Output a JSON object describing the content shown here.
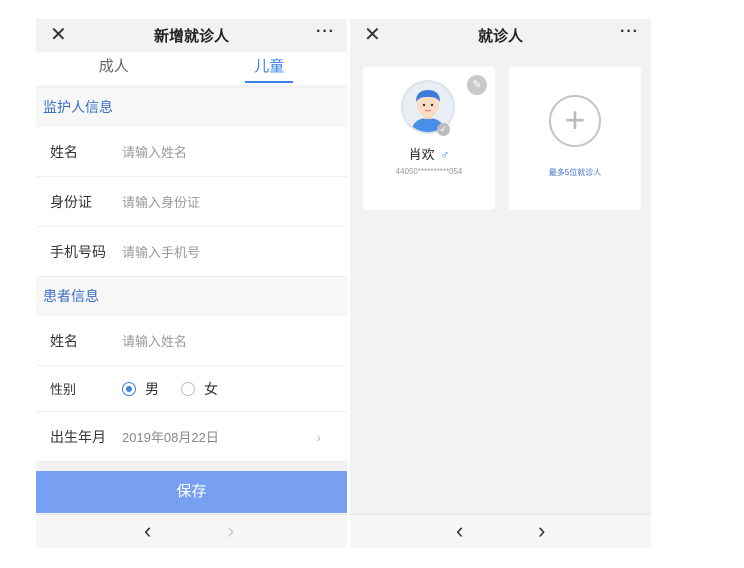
{
  "left_screen": {
    "titlebar": {
      "close_glyph": "✕",
      "title": "新增就诊人",
      "more_glyph": "···"
    },
    "tabs": [
      {
        "label": "成人",
        "active": false
      },
      {
        "label": "儿童",
        "active": true
      }
    ],
    "guardian_section": {
      "heading": "监护人信息",
      "rows": [
        {
          "label": "姓名",
          "placeholder": "请输入姓名"
        },
        {
          "label": "身份证",
          "placeholder": "请输入身份证"
        },
        {
          "label": "手机号码",
          "placeholder": "请输入手机号"
        }
      ]
    },
    "patient_section": {
      "heading": "患者信息",
      "name_label": "姓名",
      "name_placeholder": "请输入姓名",
      "gender_label": "性别",
      "gender_options": [
        {
          "label": "男",
          "selected": true
        },
        {
          "label": "女",
          "selected": false
        }
      ],
      "birth_label": "出生年月",
      "birth_value": "2019年08月22日",
      "chevron_glyph": "›"
    },
    "save_label": "保存",
    "nav": {
      "back_glyph": "‹",
      "forward_glyph": "›",
      "forward_enabled": false
    }
  },
  "right_screen": {
    "titlebar": {
      "close_glyph": "✕",
      "title": "就诊人",
      "more_glyph": "···"
    },
    "patient_card": {
      "name": "肖欢",
      "gender_symbol": "♂",
      "id_masked": "44050**********054",
      "edit_icon": "edit-icon",
      "edit_glyph": "✎",
      "check_glyph": "✓"
    },
    "add_card": {
      "plus_glyph": "+",
      "hint": "最多5位就诊人"
    },
    "nav": {
      "back_glyph": "‹",
      "forward_glyph": "›",
      "forward_enabled": true
    }
  },
  "colors": {
    "accent": "#3a82e4",
    "section_heading": "#3a6fc4",
    "save_button": "#77a0f2",
    "background": "#f2f2f2"
  }
}
